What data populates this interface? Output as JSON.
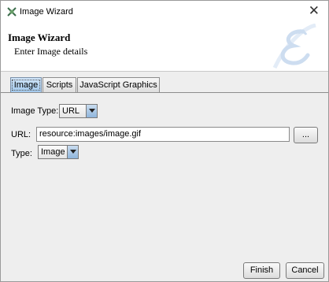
{
  "window": {
    "title": "Image Wizard"
  },
  "banner": {
    "heading": "Image Wizard",
    "subtitle": "Enter Image details"
  },
  "tabs": [
    {
      "label": "Image",
      "selected": true
    },
    {
      "label": "Scripts",
      "selected": false
    },
    {
      "label": "JavaScript Graphics",
      "selected": false
    }
  ],
  "form": {
    "image_type_label": "Image Type:",
    "image_type_value": "URL",
    "url_label": "URL:",
    "url_value": "resource:images/image.gif",
    "browse_label": "...",
    "type_label": "Type:",
    "type_value": "Image"
  },
  "buttons": {
    "finish": "Finish",
    "cancel": "Cancel"
  },
  "colors": {
    "tab_selected": "#9fc7ec",
    "combo_arrow": "#8fb5dc"
  },
  "icons": {
    "app": "wizard-app-icon",
    "close": "close-icon",
    "logo": "script-e-logo"
  }
}
